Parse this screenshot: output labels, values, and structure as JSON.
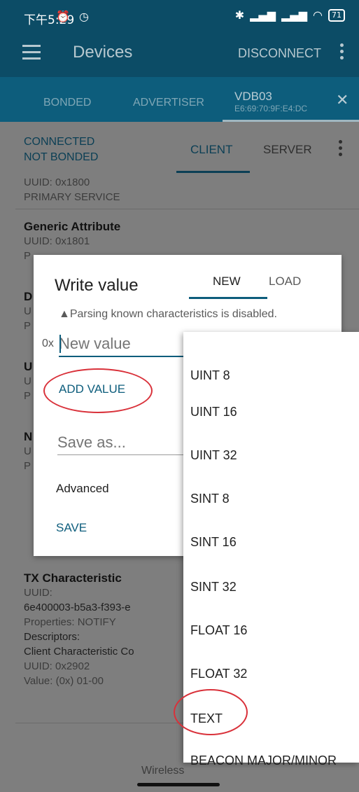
{
  "status_bar": {
    "time": "下午5:29",
    "battery": "71"
  },
  "app_bar": {
    "title": "Devices",
    "disconnect_label": "DISCONNECT"
  },
  "device_tabs": {
    "tabs": [
      "BONDED",
      "ADVERTISER"
    ],
    "active_device": {
      "name": "VDB03",
      "address": "E6:69:70:9F:E4:DC"
    },
    "close_glyph": "✕"
  },
  "connection": {
    "state_line1": "CONNECTED",
    "state_line2": "NOT BONDED",
    "tab_client": "CLIENT",
    "tab_server": "SERVER"
  },
  "services": [
    {
      "uuid": "UUID: 0x1800",
      "type": "PRIMARY SERVICE"
    },
    {
      "name": "Generic Attribute",
      "uuid": "UUID: 0x1801",
      "type": "P"
    },
    {
      "name": "D",
      "uuid": "U",
      "type": "P"
    },
    {
      "name": "U",
      "uuid": "U",
      "type": "P"
    },
    {
      "name": "N",
      "uuid": "U",
      "type": "P"
    }
  ],
  "tx_characteristic": {
    "name": "TX Characteristic",
    "uuid_label": "UUID:",
    "uuid_value": "6e400003-b5a3-f393-e",
    "properties": "Properties: NOTIFY",
    "descriptors_label": "Descriptors:",
    "descriptor_name": "Client Characteristic Co",
    "descriptor_uuid": "UUID: 0x2902",
    "descriptor_value": "Value: (0x) 01-00"
  },
  "dialog": {
    "title": "Write value",
    "tab_new": "NEW",
    "tab_load": "LOAD",
    "warning": "Parsing known characteristics is disabled.",
    "prefix": "0x",
    "value_placeholder": "New value",
    "add_value": "ADD VALUE",
    "save_as_placeholder": "Save as...",
    "advanced": "Advanced",
    "save": "SAVE"
  },
  "dropdown": {
    "options": [
      "UINT 8",
      "UINT 16",
      "UINT 32",
      "SINT 8",
      "SINT 16",
      "SINT 32",
      "FLOAT 16",
      "FLOAT 32",
      "TEXT",
      "BEACON MAJOR/MINOR"
    ]
  },
  "footer": {
    "text": "Wireless"
  },
  "colors": {
    "primary": "#0d5d7c",
    "annotation": "#d9313a"
  }
}
